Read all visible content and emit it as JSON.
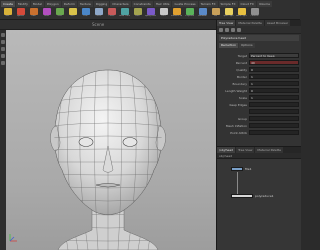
{
  "shelf": {
    "tabs": [
      "Create",
      "Modify",
      "Model",
      "Polygon",
      "Deform",
      "Texture",
      "Rigging",
      "Characters",
      "Constraints",
      "Hair Utils",
      "Guide Process",
      "Terrain FX",
      "Simple FX",
      "Cloud FX",
      "Volume"
    ],
    "tools": [
      {
        "icon": "box-icon",
        "label": "Box",
        "color": "#d9b23a"
      },
      {
        "icon": "sphere-icon",
        "label": "Sphere",
        "color": "#d54a3a"
      },
      {
        "icon": "tube-icon",
        "label": "Tube",
        "color": "#c9702e"
      },
      {
        "icon": "torus-icon",
        "label": "Torus",
        "color": "#b34fbf"
      },
      {
        "icon": "grid-icon",
        "label": "Grid",
        "color": "#6aa84f"
      },
      {
        "icon": "null-icon",
        "label": "Null",
        "color": "#d9c24a"
      },
      {
        "icon": "line-icon",
        "label": "Line",
        "color": "#4a86c8"
      },
      {
        "icon": "circle-icon",
        "label": "Circle",
        "color": "#8fa8c8"
      },
      {
        "icon": "curve-icon",
        "label": "Curve",
        "color": "#c85a5a"
      },
      {
        "icon": "draw-curve-icon",
        "label": "Draw Curve",
        "color": "#4fa3a3"
      },
      {
        "icon": "path-icon",
        "label": "Path",
        "color": "#a3a34f"
      },
      {
        "icon": "spray-paint-icon",
        "label": "Spray Paint",
        "color": "#7a5ac8"
      },
      {
        "icon": "font-icon",
        "label": "Font",
        "color": "#c8c8c8"
      },
      {
        "icon": "platonic-icon",
        "label": "Platonic Solids",
        "color": "#e0a030"
      },
      {
        "icon": "lsystem-icon",
        "label": "L-System",
        "color": "#5ab35a"
      },
      {
        "icon": "metaball-icon",
        "label": "Metaball",
        "color": "#5a8ac8"
      },
      {
        "icon": "file-icon",
        "label": "File",
        "color": "#c8a05a"
      },
      {
        "icon": "spotlight-icon",
        "label": "Spot Light",
        "color": "#e8d060"
      },
      {
        "icon": "arealight-icon",
        "label": "Area Light",
        "color": "#e8c040"
      },
      {
        "icon": "camera-icon",
        "label": "Camera",
        "color": "#909090"
      }
    ]
  },
  "viewport": {
    "title": "Scene"
  },
  "right": {
    "tabs": [
      "Tree View",
      "Material Palette",
      "Asset Browser"
    ],
    "param": {
      "node_title": "Polyreduce  head",
      "subtabs": [
        "Reduction",
        "Options"
      ],
      "rows": [
        {
          "label": "Target",
          "value": "Percent to Keep",
          "style": "dd"
        },
        {
          "label": "Percent",
          "value": "40",
          "style": "hl"
        },
        {
          "label": "Quality",
          "value": "0",
          "style": ""
        },
        {
          "label": "Border",
          "value": "1",
          "style": ""
        },
        {
          "label": "Boundary",
          "value": "1",
          "style": ""
        },
        {
          "label": "Length Weight",
          "value": "0",
          "style": ""
        },
        {
          "label": "Scale",
          "value": "1",
          "style": ""
        },
        {
          "label": "Keep Edges",
          "value": "",
          "style": ""
        },
        {
          "label": "",
          "value": "",
          "style": ""
        },
        {
          "label": "Group",
          "value": "",
          "style": ""
        },
        {
          "label": "Mesh Inflation",
          "value": "",
          "style": ""
        },
        {
          "label": "Point Attrib",
          "value": "",
          "style": ""
        }
      ]
    },
    "net": {
      "tabs": [
        "/obj/head",
        "Tree View",
        "Material Palette"
      ],
      "path": "obj  head",
      "nodes": [
        {
          "label": "file1",
          "color": "#7aa0c8"
        },
        {
          "label": "polyreduce1",
          "color": "#d8d8d8"
        }
      ]
    }
  }
}
